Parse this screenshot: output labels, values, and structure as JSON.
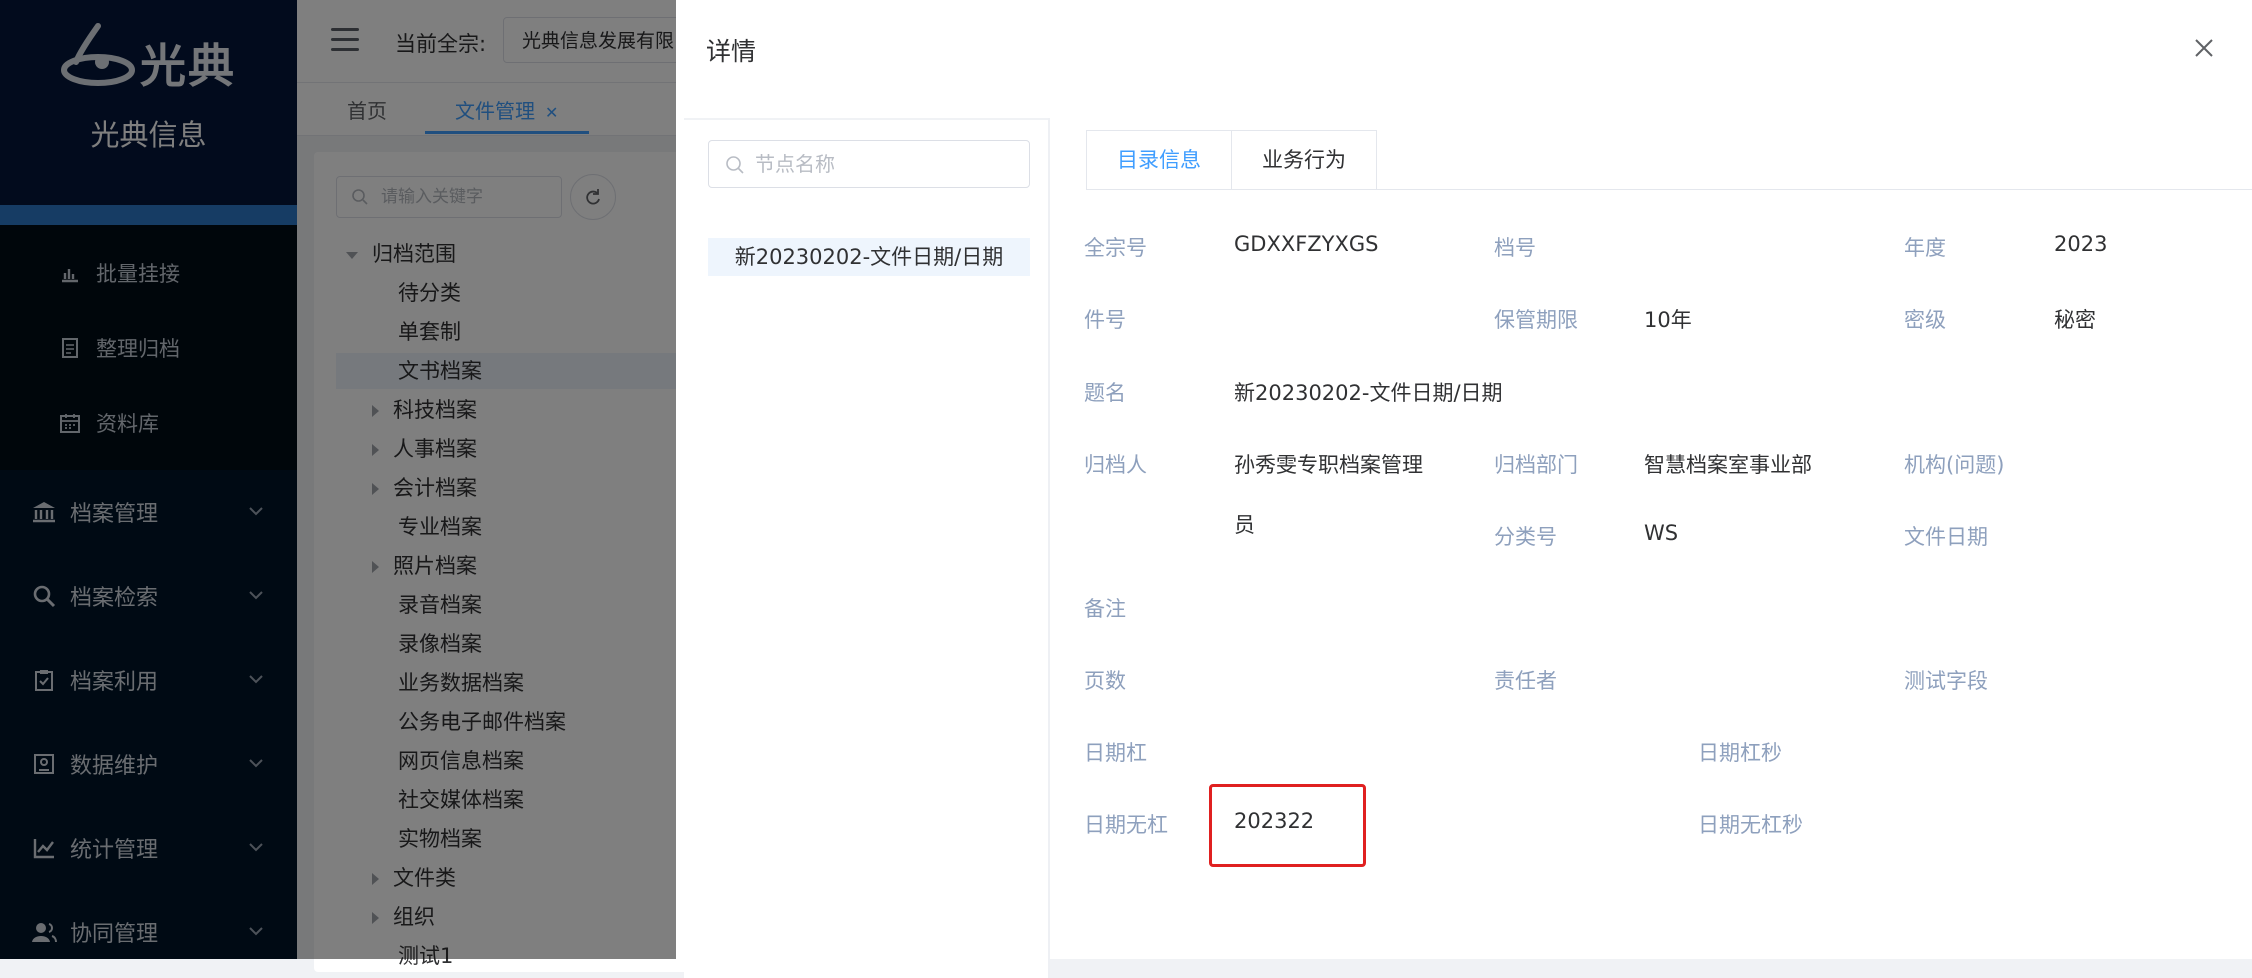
{
  "sidebar": {
    "logo_text": "光典",
    "brand_name": "光典信息",
    "sub_items": [
      {
        "label": "批量挂接",
        "icon": "bar-chart-icon"
      },
      {
        "label": "整理归档",
        "icon": "document-icon"
      },
      {
        "label": "资料库",
        "icon": "calendar-icon"
      }
    ],
    "menu_items": [
      {
        "label": "档案管理",
        "icon": "bank-icon"
      },
      {
        "label": "档案检索",
        "icon": "search-icon"
      },
      {
        "label": "档案利用",
        "icon": "clipboard-check-icon"
      },
      {
        "label": "数据维护",
        "icon": "database-icon"
      },
      {
        "label": "统计管理",
        "icon": "line-chart-icon"
      },
      {
        "label": "协同管理",
        "icon": "users-icon"
      }
    ]
  },
  "topbar": {
    "org_label": "当前全宗:",
    "org_value": "光典信息发展有限"
  },
  "page_tabs": [
    {
      "label": "首页"
    },
    {
      "label": "文件管理"
    }
  ],
  "tree": {
    "search_placeholder": "请输入关键字",
    "root": "归档范围",
    "nodes": [
      "待分类",
      "单套制",
      "文书档案",
      "科技档案",
      "人事档案",
      "会计档案",
      "专业档案",
      "照片档案",
      "录音档案",
      "录像档案",
      "业务数据档案",
      "公务电子邮件档案",
      "网页信息档案",
      "社交媒体档案",
      "实物档案",
      "文件类",
      "组织",
      "测试1"
    ]
  },
  "drawer": {
    "title": "详情",
    "node_search_placeholder": "节点名称",
    "node_item": "新20230202-文件日期/日期",
    "tabs": [
      {
        "label": "目录信息"
      },
      {
        "label": "业务行为"
      }
    ],
    "fields": {
      "qzh_label": "全宗号",
      "qzh_value": "GDXXFZYXGS",
      "dh_label": "档号",
      "dh_value": "",
      "nd_label": "年度",
      "nd_value": "2023",
      "jh_label": "件号",
      "jh_value": "",
      "bgqx_label": "保管期限",
      "bgqx_value": "10年",
      "mj_label": "密级",
      "mj_value": "秘密",
      "tm_label": "题名",
      "tm_value": "新20230202-文件日期/日期",
      "gdr_label": "归档人",
      "gdr_value_line1": "孙秀雯专职档案管理",
      "gdr_value_line2": "员",
      "gdbm_label": "归档部门",
      "gdbm_value": "智慧档案室事业部",
      "jg_label": "机构(问题)",
      "flh_label": "分类号",
      "flh_value": "WS",
      "wjrq_label": "文件日期",
      "bz_label": "备注",
      "ys_label": "页数",
      "zrz_label": "责任者",
      "cszd_label": "测试字段",
      "rqg_label": "日期杠",
      "rqgm_label": "日期杠秒",
      "rqwg_label": "日期无杠",
      "rqwg_value": "202322",
      "rqwgm_label": "日期无杠秒"
    }
  },
  "colors": {
    "sidebar_bg": "#001529",
    "accent": "#409eff",
    "highlight": "#e02020"
  }
}
